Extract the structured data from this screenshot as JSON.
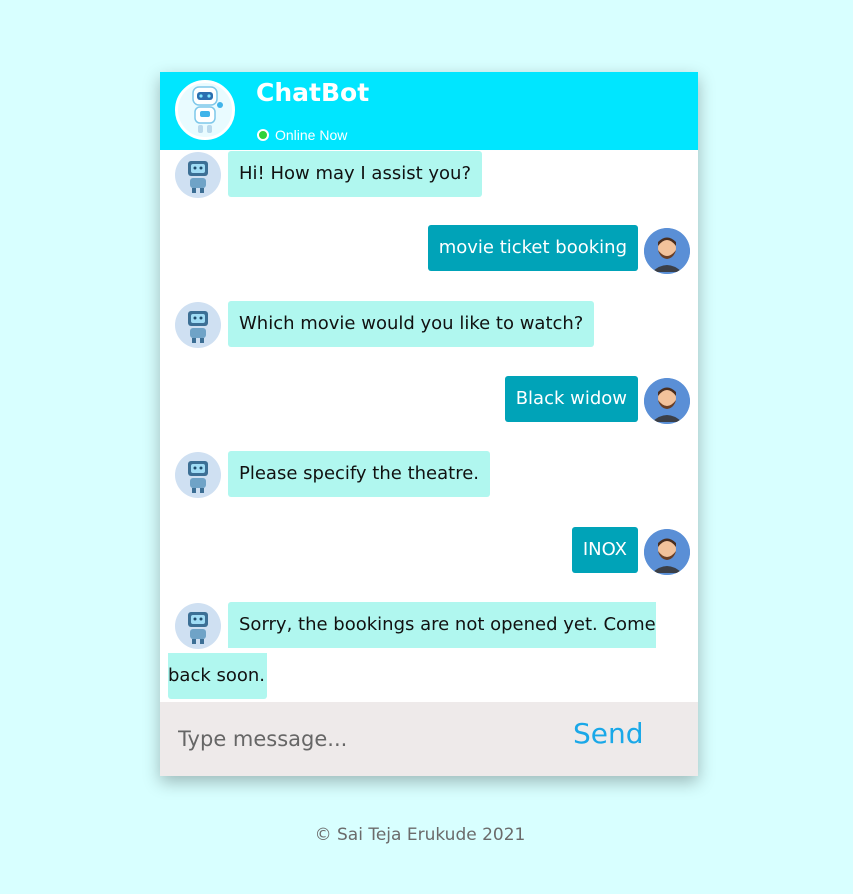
{
  "header": {
    "title": "ChatBot",
    "status": "Online Now",
    "status_color": "#2fd33a",
    "bg_color": "#00e6ff"
  },
  "messages": [
    {
      "sender": "bot",
      "text": "Hi! How may I assist you?"
    },
    {
      "sender": "user",
      "text": "movie ticket booking"
    },
    {
      "sender": "bot",
      "text": "Which movie would you like to watch?"
    },
    {
      "sender": "user",
      "text": "Black widow"
    },
    {
      "sender": "bot",
      "text": "Please specify the theatre."
    },
    {
      "sender": "user",
      "text": "INOX"
    },
    {
      "sender": "bot",
      "text_line1": "Sorry, the bookings are not opened yet. Come",
      "text_line2": "back soon."
    }
  ],
  "composer": {
    "placeholder": "Type message...",
    "send_label": "Send"
  },
  "footer": {
    "text": "© Sai Teja Erukude 2021"
  },
  "colors": {
    "page_bg": "#d8ffff",
    "bot_bubble": "#b0f7ef",
    "user_bubble": "#00a3b8",
    "send_text": "#1aa8e8"
  },
  "icons": {
    "header_avatar": "robot-icon",
    "bot_avatar": "robot-icon",
    "user_avatar": "user-avatar-icon"
  }
}
